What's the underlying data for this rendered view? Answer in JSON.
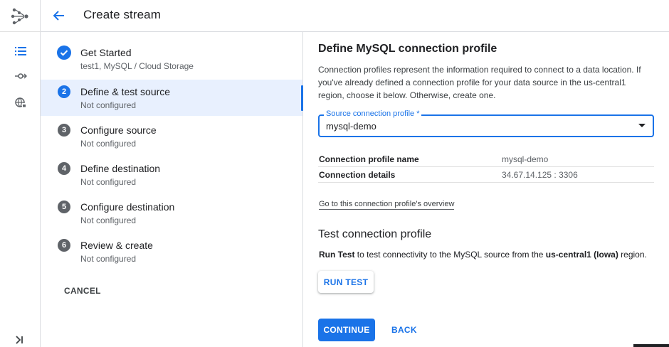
{
  "header": {
    "title": "Create stream"
  },
  "steps": [
    {
      "num": "1",
      "label": "Get Started",
      "sub": "test1, MySQL / Cloud Storage",
      "state": "done"
    },
    {
      "num": "2",
      "label": "Define & test source",
      "sub": "Not configured",
      "state": "active"
    },
    {
      "num": "3",
      "label": "Configure source",
      "sub": "Not configured",
      "state": "todo"
    },
    {
      "num": "4",
      "label": "Define destination",
      "sub": "Not configured",
      "state": "todo"
    },
    {
      "num": "5",
      "label": "Configure destination",
      "sub": "Not configured",
      "state": "todo"
    },
    {
      "num": "6",
      "label": "Review & create",
      "sub": "Not configured",
      "state": "todo"
    }
  ],
  "cancel_label": "CANCEL",
  "main": {
    "heading": "Define MySQL connection profile",
    "description": "Connection profiles represent the information required to connect to a data location. If you've already defined a connection profile for your data source in the us-central1 region, choose it below. Otherwise, create one.",
    "select": {
      "label": "Source connection profile *",
      "value": "mysql-demo"
    },
    "details": [
      {
        "key": "Connection profile name",
        "value": "mysql-demo"
      },
      {
        "key": "Connection details",
        "value": "34.67.14.125 : 3306"
      }
    ],
    "overview_link": "Go to this connection profile's overview",
    "test_heading": "Test connection profile",
    "test_text": {
      "bold1": "Run Test",
      "mid": " to test connectivity to the MySQL source from the ",
      "bold2": "us-central1 (Iowa)",
      "end": " region."
    },
    "run_test_label": "RUN TEST",
    "continue_label": "CONTINUE",
    "back_label": "BACK"
  },
  "colors": {
    "accent": "#1a73e8",
    "active_bg": "#e8f0fe",
    "step_grey": "#5f6368"
  },
  "icons": {
    "rail": [
      "datastream-logo-icon",
      "streams-list-icon",
      "connection-profiles-icon",
      "private-connectivity-icon",
      "expand-rail-icon"
    ],
    "header": "back-arrow-icon",
    "done_step": "check-circle-icon",
    "select": "dropdown-arrow-icon"
  }
}
